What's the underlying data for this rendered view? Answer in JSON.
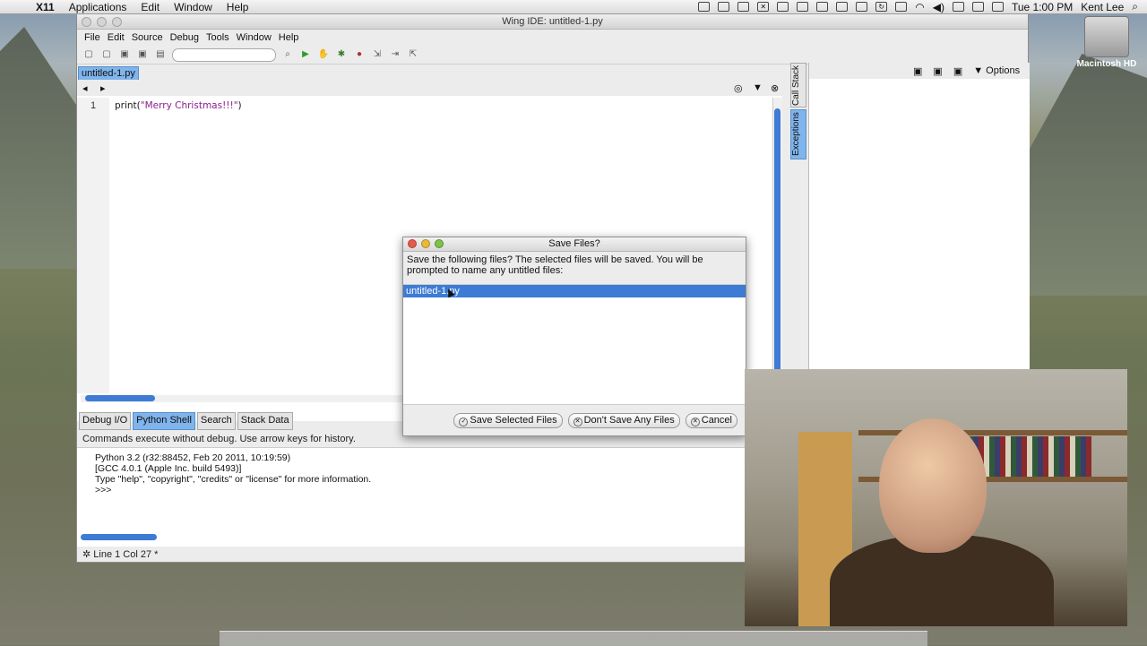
{
  "menubar": {
    "app": "X11",
    "items": [
      "Applications",
      "Edit",
      "Window",
      "Help"
    ],
    "clock": "Tue 1:00 PM",
    "user": "Kent Lee"
  },
  "desktop": {
    "hd_label": "Macintosh HD"
  },
  "wing": {
    "title": "Wing IDE: untitled-1.py",
    "menus": [
      "File",
      "Edit",
      "Source",
      "Debug",
      "Tools",
      "Window",
      "Help"
    ],
    "editor_tab": "untitled-1.py",
    "line_number": "1",
    "code_func": "print(",
    "code_string": "\"Merry Christmas!!!\"",
    "code_close": ")",
    "right_tabs": [
      "Call Stack",
      "Exceptions"
    ],
    "options_label": "Options",
    "bottom_tabs": [
      "Debug I/O",
      "Python Shell",
      "Search",
      "Stack Data"
    ],
    "shell_hint": "Commands execute without debug.  Use arrow keys for history.",
    "shell_output": [
      "Python 3.2 (r32:88452, Feb 20 2011, 10:19:59)",
      "[GCC 4.0.1 (Apple Inc. build 5493)]",
      "Type \"help\", \"copyright\", \"credits\" or \"license\" for more information.",
      ">>>"
    ],
    "status": "Line 1 Col 27 *"
  },
  "dialog": {
    "title": "Save Files?",
    "message": "Save the following files?  The selected files will be saved.  You will be prompted to name any untitled files:",
    "files": [
      "untitled-1.py"
    ],
    "buttons": {
      "save": "Save Selected Files",
      "dont_save": "Don't Save Any Files",
      "cancel": "Cancel"
    }
  },
  "colors": {
    "selection": "#3d7bd4",
    "active_tab": "#7fb4ec"
  }
}
